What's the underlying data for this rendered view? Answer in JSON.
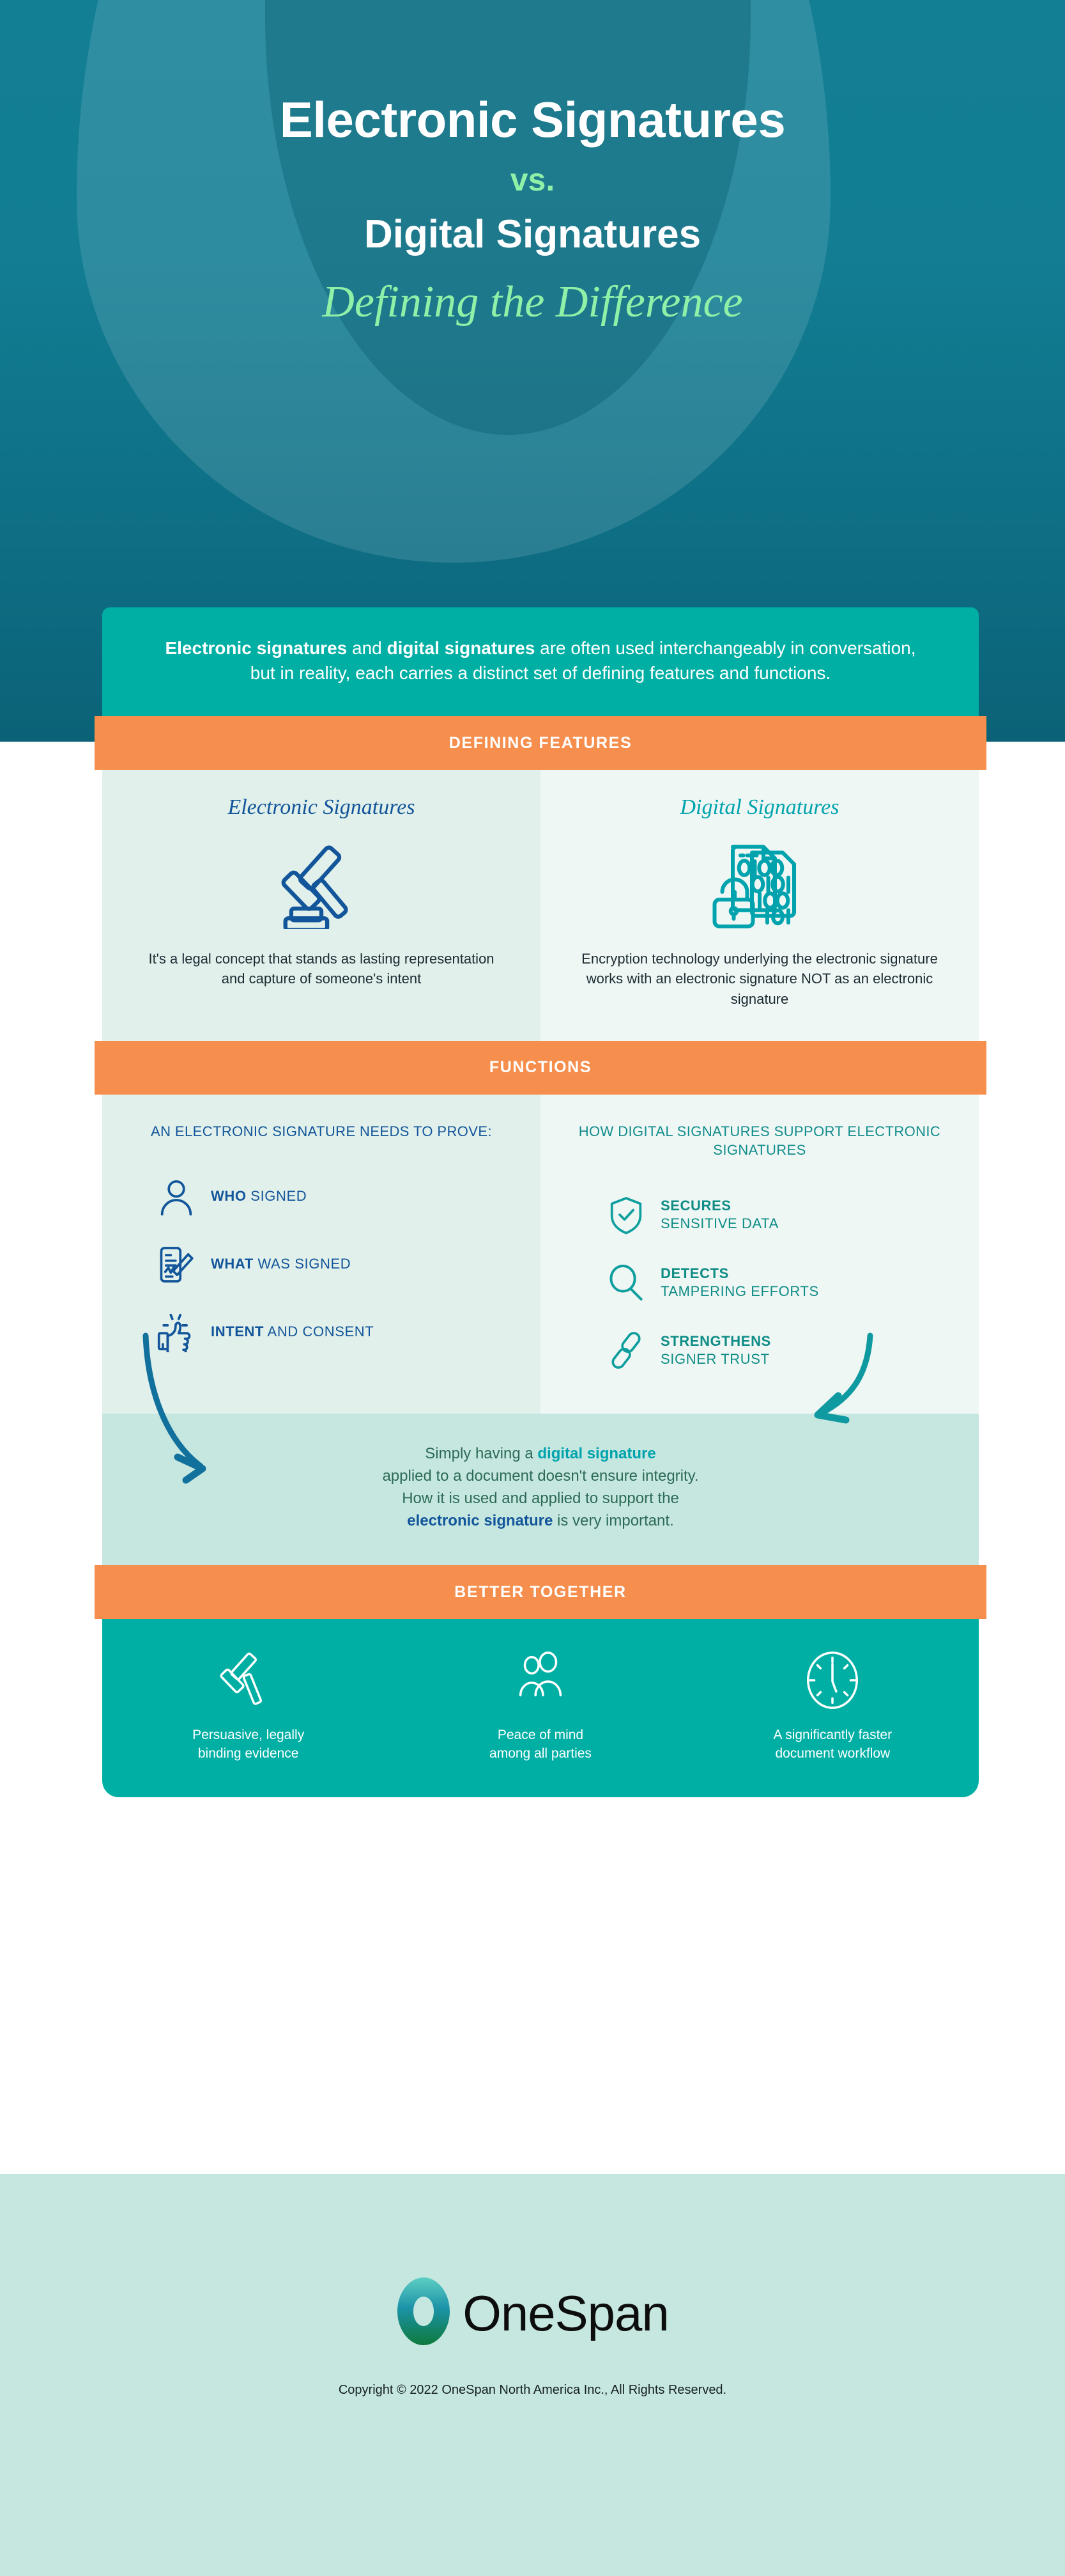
{
  "hero": {
    "title_line1": "Electronic Signatures",
    "vs": "vs.",
    "title_line2": "Digital Signatures",
    "subtitle": "Defining the Difference"
  },
  "intro": {
    "bold1": "Electronic signatures",
    "mid": " and ",
    "bold2": "digital signatures",
    "rest": " are often used interchangeably in conversation, but in reality, each carries a distinct set of defining features and functions."
  },
  "section_defining_features": {
    "bar_label": "DEFINING FEATURES",
    "columns": [
      {
        "title": "Electronic Signatures",
        "icon": "gavel-icon",
        "body": "It's a legal concept that stands as lasting representation and capture of someone's intent"
      },
      {
        "title": "Digital Signatures",
        "icon": "encrypted-document-lock-icon",
        "body": "Encryption technology underlying the electronic signature works with an electronic signature NOT as an electronic signature"
      }
    ]
  },
  "section_functions": {
    "bar_label": "FUNCTIONS",
    "left": {
      "heading": "AN ELECTRONIC SIGNATURE NEEDS TO PROVE:",
      "rows": [
        {
          "icon": "person-icon",
          "bold": "WHO",
          "rest": " SIGNED"
        },
        {
          "icon": "signed-document-icon",
          "bold": "WHAT",
          "rest": " WAS SIGNED"
        },
        {
          "icon": "thumbs-up-icon",
          "bold": "INTENT",
          "rest": " AND CONSENT"
        }
      ]
    },
    "right": {
      "heading": "HOW DIGITAL SIGNATURES SUPPORT ELECTRONIC SIGNATURES",
      "rows": [
        {
          "icon": "shield-check-icon",
          "bold": "SECURES",
          "rest": "SENSITIVE DATA"
        },
        {
          "icon": "magnifier-icon",
          "bold": "DETECTS",
          "rest": "TAMPERING EFFORTS"
        },
        {
          "icon": "chain-link-icon",
          "bold": "STRENGTHENS",
          "rest": "SIGNER TRUST"
        }
      ]
    }
  },
  "note": {
    "l1a": "Simply having a ",
    "l1b": "digital signature",
    "l2": "applied to a document doesn't ensure integrity.",
    "l3": "How it is used and applied to support the",
    "l4a": "electronic signature",
    "l4b": " is very important."
  },
  "section_better_together": {
    "bar_label": "BETTER TOGETHER",
    "items": [
      {
        "icon": "gavel-outline-icon",
        "line1": "Persuasive, legally",
        "line2": "binding evidence"
      },
      {
        "icon": "two-people-icon",
        "line1": "Peace of mind",
        "line2": "among all parties"
      },
      {
        "icon": "clock-icon",
        "line1": "A significantly faster",
        "line2": "document workflow"
      }
    ]
  },
  "footer": {
    "brand": "OneSpan",
    "copyright": "Copyright © 2022 OneSpan North America Inc., All Rights Reserved."
  },
  "colors": {
    "hero_teal": "#137f95",
    "teal": "#00AFA4",
    "orange": "#F68F4E",
    "mint_light": "#E1F0EA",
    "mint_lighter": "#EEF7F4",
    "mint_band": "#C6E7E0",
    "navy": "#12559A",
    "deep_teal": "#0F8C86",
    "green_accent": "#8ff0a8"
  }
}
